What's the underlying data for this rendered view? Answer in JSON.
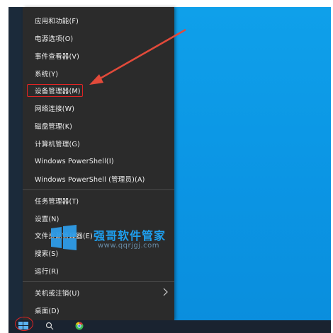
{
  "menu": {
    "items": [
      {
        "label": "应用和功能(F)"
      },
      {
        "label": "电源选项(O)"
      },
      {
        "label": "事件查看器(V)"
      },
      {
        "label": "系统(Y)"
      },
      {
        "label": "设备管理器(M)"
      },
      {
        "label": "网络连接(W)"
      },
      {
        "label": "磁盘管理(K)"
      },
      {
        "label": "计算机管理(G)"
      },
      {
        "label": "Windows PowerShell(I)"
      },
      {
        "label": "Windows PowerShell (管理员)(A)"
      },
      {
        "label": "任务管理器(T)"
      },
      {
        "label": "设置(N)"
      },
      {
        "label": "文件资源管理器(E)"
      },
      {
        "label": "搜索(S)"
      },
      {
        "label": "运行(R)"
      },
      {
        "label": "关机或注销(U)"
      },
      {
        "label": "桌面(D)"
      }
    ]
  },
  "watermark": {
    "title": "强哥软件管家",
    "url": "www.qqrjgj.com"
  },
  "colors": {
    "menu_bg": "#2b2b2b",
    "desktop": "#0fa0ea",
    "highlight": "#e02424",
    "watermark": "#1ea0f0"
  },
  "icons": [
    "chevron-right-icon",
    "windows-logo-icon",
    "windows-watermark-logo"
  ]
}
